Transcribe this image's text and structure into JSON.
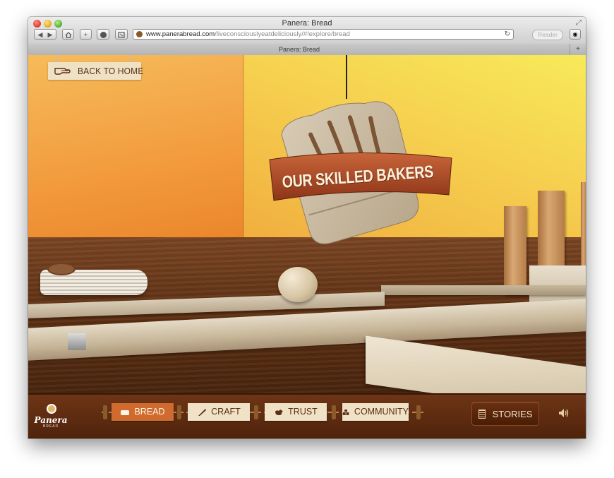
{
  "window": {
    "title": "Panera: Bread"
  },
  "toolbar": {
    "url_host": "www.panerabread.com",
    "url_path": "/liveconsciouslyeatdeliciously/#!explore/bread",
    "reader_label": "Reader",
    "add_bookmark_glyph": "+",
    "new_tab_glyph": "+"
  },
  "tab": {
    "title": "Panera: Bread"
  },
  "page": {
    "back_label": "BACK TO HOME",
    "banner_text": "OUR SKILLED BAKERS",
    "logo_word": "Panera",
    "logo_sub": "BREAD"
  },
  "nav": {
    "items": [
      {
        "label": "BREAD",
        "icon": "bread-icon",
        "active": true
      },
      {
        "label": "CRAFT",
        "icon": "knife-icon",
        "active": false
      },
      {
        "label": "TRUST",
        "icon": "chicken-icon",
        "active": false
      },
      {
        "label": "COMMUNITY",
        "icon": "boxes-icon",
        "active": false
      }
    ],
    "stories_label": "STORIES",
    "stories_icon": "document-icon",
    "sound_icon": "speaker-icon"
  },
  "colors": {
    "active_tab": "#cf6b2f",
    "button_bg": "#f0e2c7",
    "footer_bg": "#5a280e",
    "banner": "#b5552a"
  }
}
